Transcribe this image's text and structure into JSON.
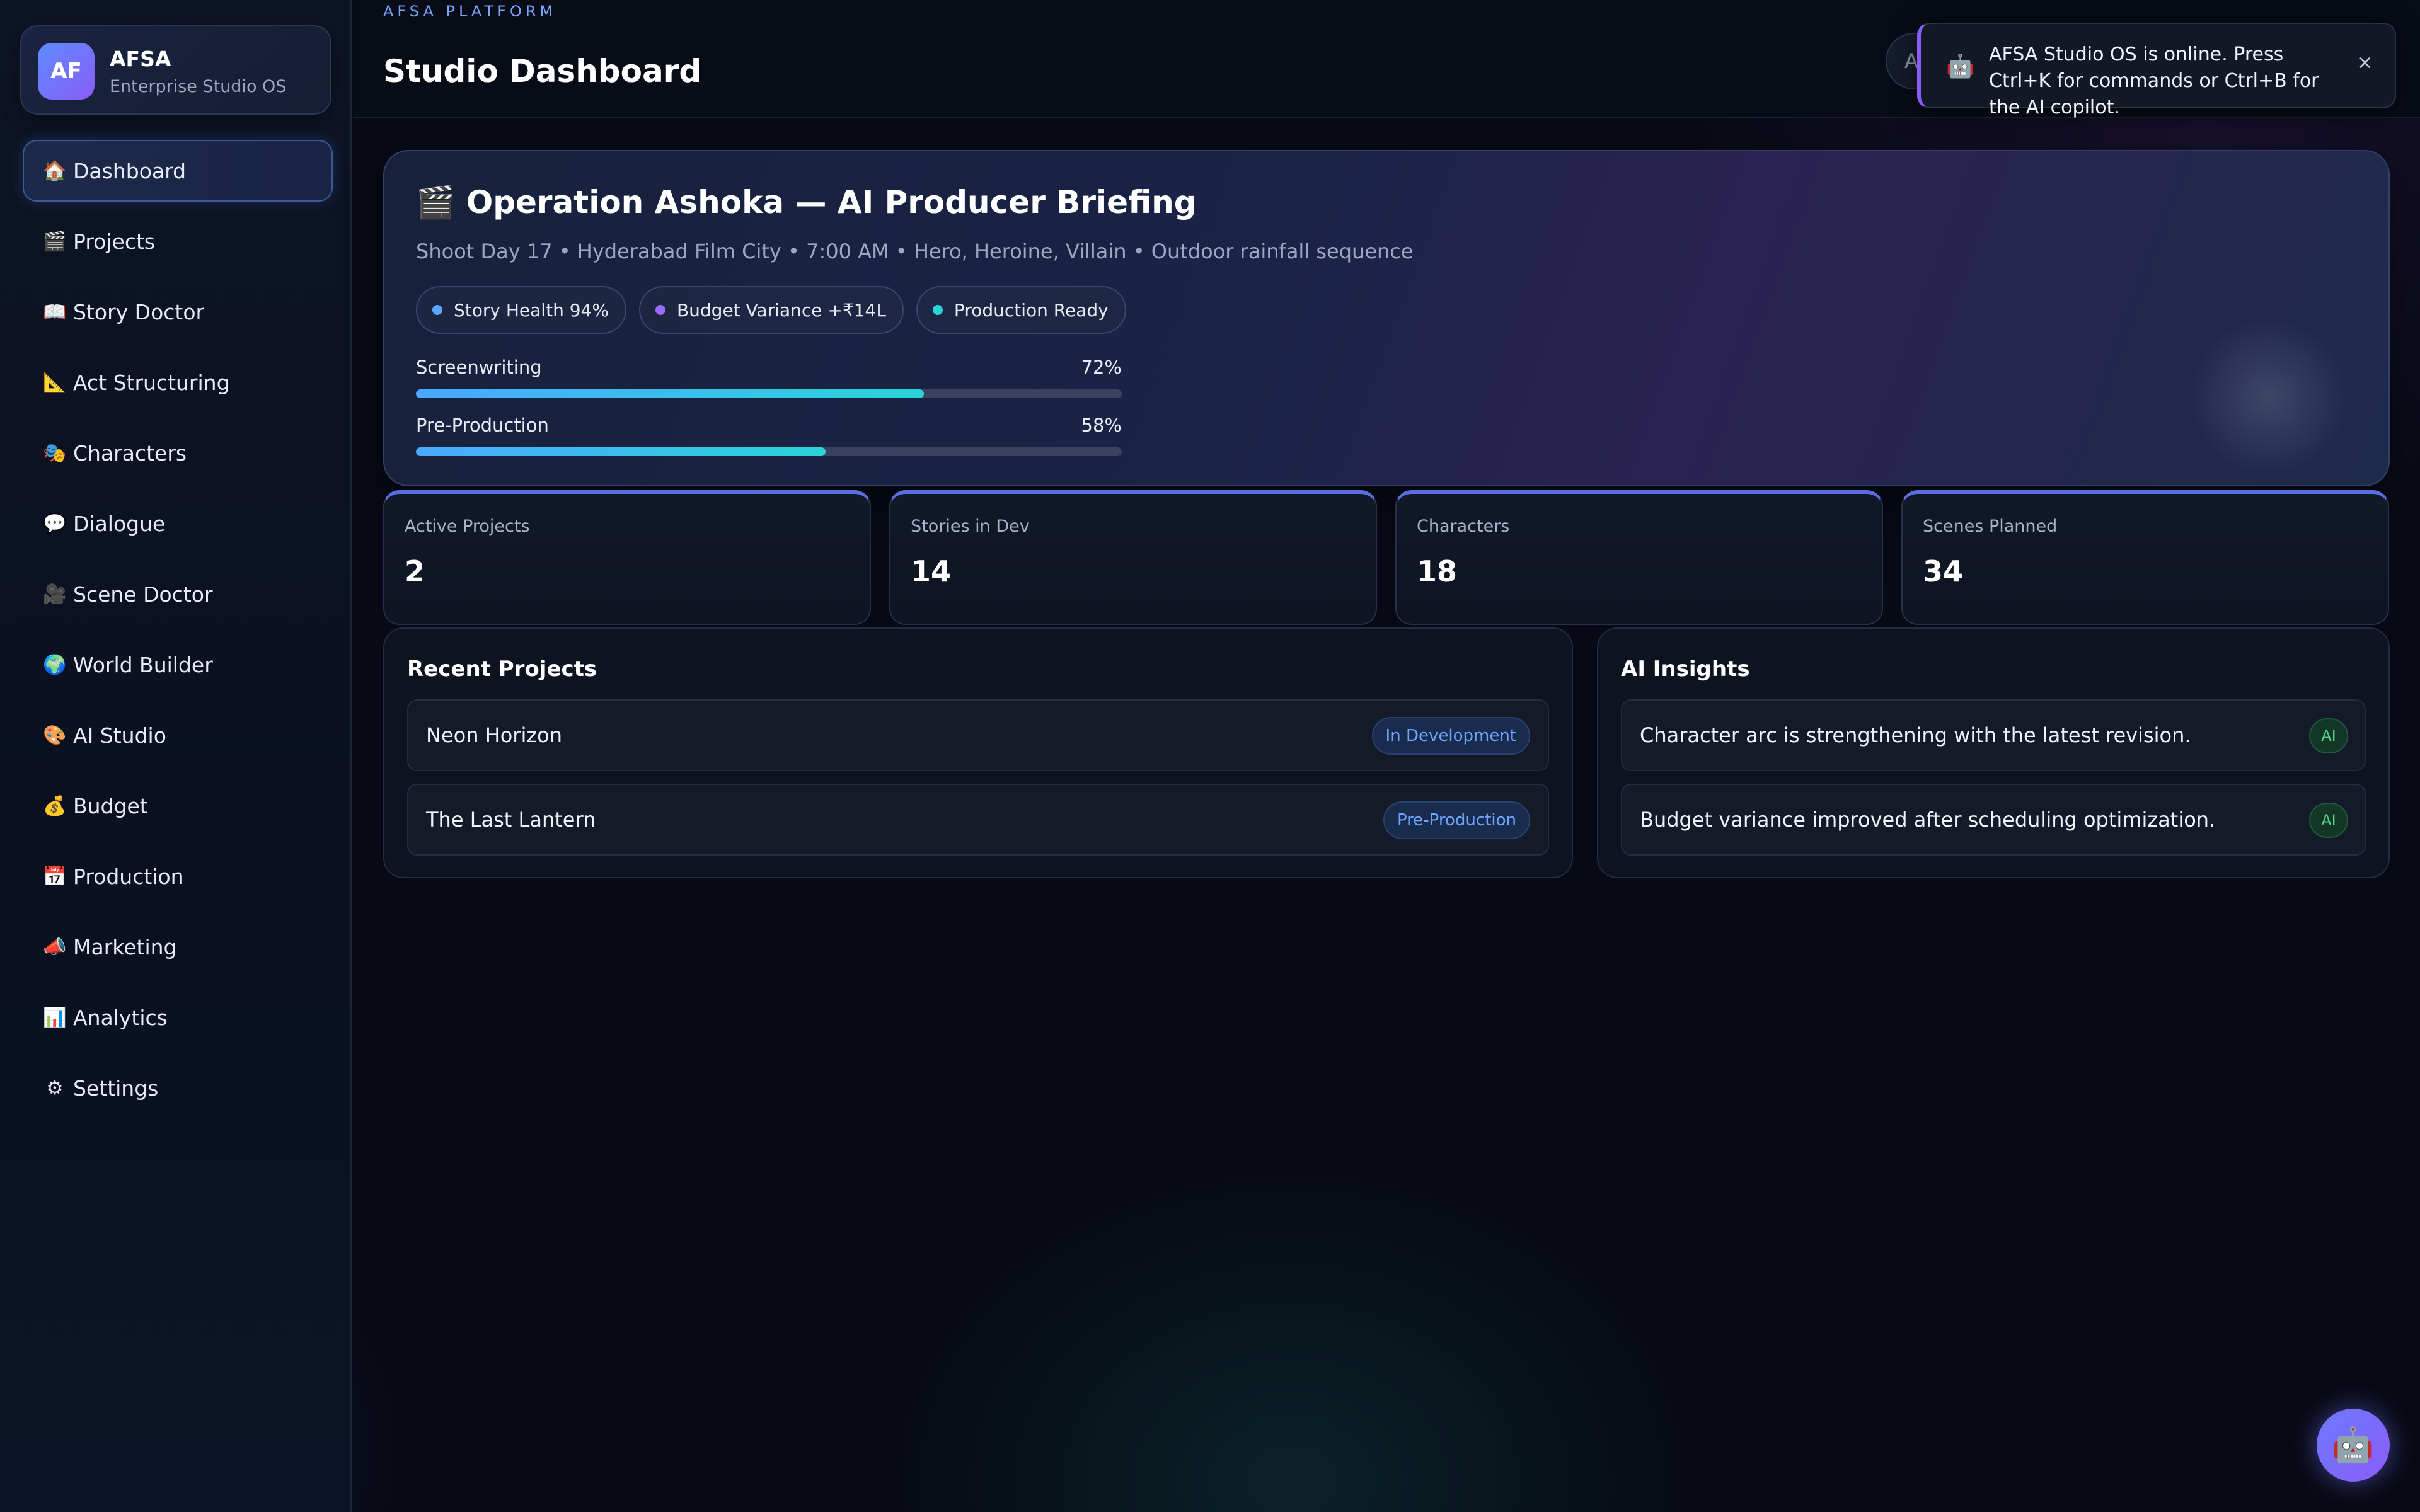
{
  "brand": {
    "logo": "AF",
    "name": "AFSA",
    "subtitle": "Enterprise Studio OS"
  },
  "nav": [
    {
      "icon": "🏠",
      "label": "Dashboard",
      "active": true
    },
    {
      "icon": "🎬",
      "label": "Projects"
    },
    {
      "icon": "📖",
      "label": "Story Doctor"
    },
    {
      "icon": "📐",
      "label": "Act Structuring"
    },
    {
      "icon": "🎭",
      "label": "Characters"
    },
    {
      "icon": "💬",
      "label": "Dialogue"
    },
    {
      "icon": "🎥",
      "label": "Scene Doctor"
    },
    {
      "icon": "🌍",
      "label": "World Builder"
    },
    {
      "icon": "🎨",
      "label": "AI Studio"
    },
    {
      "icon": "💰",
      "label": "Budget"
    },
    {
      "icon": "📅",
      "label": "Production"
    },
    {
      "icon": "📣",
      "label": "Marketing"
    },
    {
      "icon": "📊",
      "label": "Analytics"
    },
    {
      "icon": "⚙",
      "label": "Settings"
    }
  ],
  "header": {
    "eyebrow": "AFSA PLATFORM",
    "title": "Studio Dashboard",
    "pill_text": "A"
  },
  "toast": {
    "icon": "🤖",
    "message": "AFSA Studio OS is online. Press Ctrl+K for commands or Ctrl+B for the AI copilot.",
    "close": "×"
  },
  "hero": {
    "icon": "🎬",
    "title": "Operation Ashoka — AI Producer Briefing",
    "subtitle": "Shoot Day 17 • Hyderabad Film City • 7:00 AM • Hero, Heroine, Villain • Outdoor rainfall sequence",
    "chips": [
      {
        "label": "Story Health 94%",
        "color": "#5aa8ff"
      },
      {
        "label": "Budget Variance +₹14L",
        "color": "#9b6bff"
      },
      {
        "label": "Production Ready",
        "color": "#2ad4d8"
      }
    ],
    "progress": [
      {
        "label": "Screenwriting",
        "value_text": "72%",
        "value": 0.72
      },
      {
        "label": "Pre-Production",
        "value_text": "58%",
        "value": 0.58
      }
    ]
  },
  "stats": [
    {
      "label": "Active Projects",
      "value": "2"
    },
    {
      "label": "Stories in Dev",
      "value": "14"
    },
    {
      "label": "Characters",
      "value": "18"
    },
    {
      "label": "Scenes Planned",
      "value": "34"
    }
  ],
  "recent_projects": {
    "title": "Recent Projects",
    "items": [
      {
        "name": "Neon Horizon",
        "status": "In Development"
      },
      {
        "name": "The Last Lantern",
        "status": "Pre-Production"
      }
    ]
  },
  "ai_insights": {
    "title": "AI Insights",
    "items": [
      {
        "text": "Character arc is strengthening with the latest revision.",
        "badge": "AI"
      },
      {
        "text": "Budget variance improved after scheduling optimization.",
        "badge": "AI"
      }
    ]
  },
  "copilot": {
    "icon": "🤖"
  }
}
